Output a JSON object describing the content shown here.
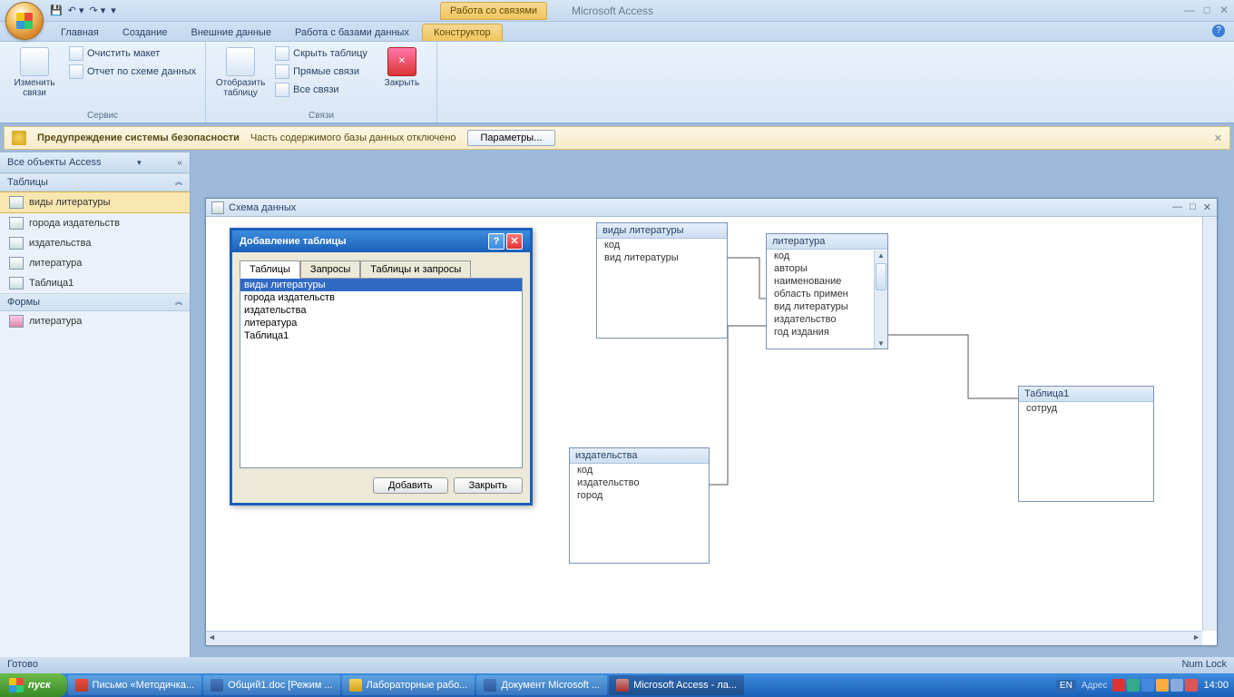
{
  "titlebar": {
    "context_tab": "Работа со связями",
    "app_title": "Microsoft Access"
  },
  "ribbon_tabs": [
    "Главная",
    "Создание",
    "Внешние данные",
    "Работа с базами данных",
    "Конструктор"
  ],
  "ribbon_active_tab": 4,
  "ribbon": {
    "group_service": {
      "label": "Сервис",
      "edit_relations": "Изменить связи",
      "clear_layout": "Очистить макет",
      "report": "Отчет по схеме данных"
    },
    "group_relations": {
      "label": "Связи",
      "show_table": "Отобразить таблицу",
      "hide_table": "Скрыть таблицу",
      "direct_rel": "Прямые связи",
      "all_rel": "Все связи",
      "close": "Закрыть"
    }
  },
  "security": {
    "title": "Предупреждение системы безопасности",
    "msg": "Часть содержимого базы данных отключено",
    "btn": "Параметры..."
  },
  "nav": {
    "header": "Все объекты Access",
    "cat_tables": "Таблицы",
    "tables": [
      "виды литературы",
      "города издательств",
      "издательства",
      "литература",
      "Таблица1"
    ],
    "selected_table": 0,
    "cat_forms": "Формы",
    "forms": [
      "литература"
    ]
  },
  "doc": {
    "title": "Схема данных"
  },
  "rel_tables": {
    "t1": {
      "title": "виды литературы",
      "fields": [
        "код",
        "вид литературы"
      ]
    },
    "t2": {
      "title": "литература",
      "fields": [
        "код",
        "авторы",
        "наименование",
        "область примен",
        "вид литературы",
        "издательство",
        "год издания"
      ]
    },
    "t3": {
      "title": "издательства",
      "fields": [
        "код",
        "издательство",
        "город"
      ]
    },
    "t4": {
      "title": "Таблица1",
      "fields": [
        "сотруд"
      ]
    }
  },
  "dialog": {
    "title": "Добавление таблицы",
    "tabs": [
      "Таблицы",
      "Запросы",
      "Таблицы и запросы"
    ],
    "active_tab": 0,
    "items": [
      "виды литературы",
      "города издательств",
      "издательства",
      "литература",
      "Таблица1"
    ],
    "selected_item": 0,
    "btn_add": "Добавить",
    "btn_close": "Закрыть"
  },
  "status": {
    "left": "Готово",
    "right": "Num Lock"
  },
  "taskbar": {
    "start": "пуск",
    "buttons": [
      "Письмо «Методичка...",
      "Общий1.doc [Режим ...",
      "Лабораторные рабо...",
      "Документ Microsoft ...",
      "Microsoft Access - ла..."
    ],
    "active": 4,
    "lang": "EN",
    "addr_label": "Адрес",
    "clock": "14:00"
  }
}
